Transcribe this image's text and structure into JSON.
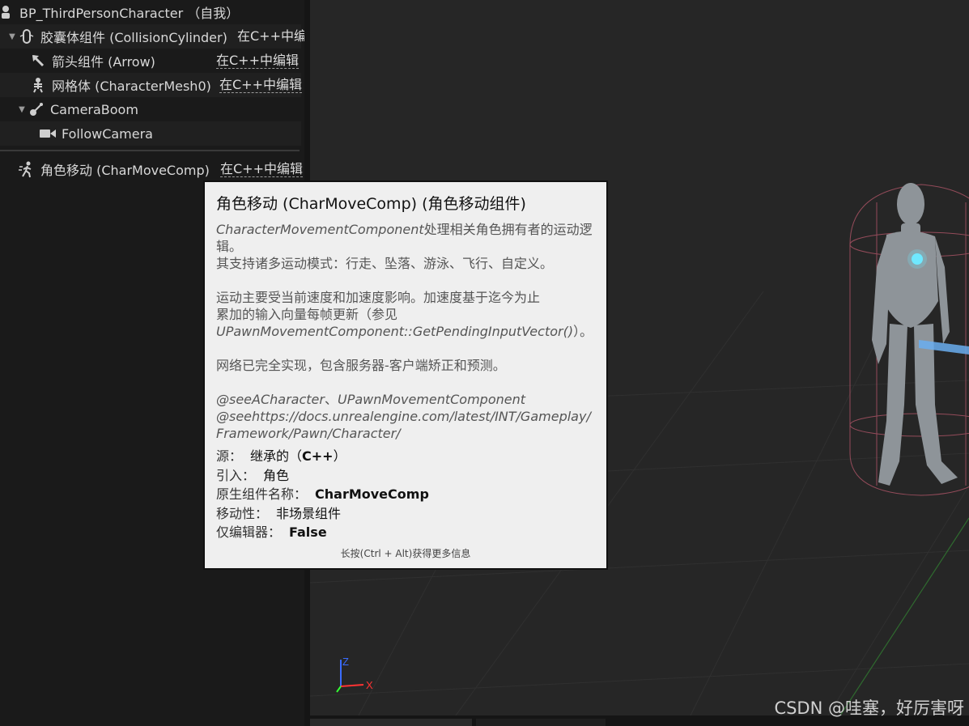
{
  "tree": {
    "root": {
      "label": "BP_ThirdPersonCharacter （自我）"
    },
    "items": [
      {
        "label": "胶囊体组件 (CollisionCylinder)",
        "edit_link": "在C++中编",
        "icon": "capsule-icon"
      },
      {
        "label": "箭头组件 (Arrow)",
        "edit_link": "在C++中编辑",
        "icon": "arrow-icon"
      },
      {
        "label": "网格体 (CharacterMesh0)",
        "edit_link": "在C++中编辑",
        "icon": "skeletal-mesh-icon"
      },
      {
        "label": "CameraBoom",
        "edit_link": "",
        "icon": "spring-arm-icon"
      },
      {
        "label": "FollowCamera",
        "edit_link": "",
        "icon": "camera-icon"
      }
    ],
    "movement": {
      "label": "角色移动 (CharMoveComp)",
      "edit_link": "在C++中编辑",
      "icon": "character-movement-icon"
    }
  },
  "tooltip": {
    "title": "角色移动 (CharMoveComp) (角色移动组件)",
    "desc": {
      "p1_class": "CharacterMovementComponent",
      "p1_text": "处理相关角色拥有者的运动逻辑。",
      "p2": "其支持诸多运动模式：行走、坠落、游泳、飞行、自定义。",
      "p3_line1": "运动主要受当前速度和加速度影响。加速度基于迄今为止",
      "p3_line2": "累加的输入向量每帧更新（参见",
      "p3_func": "UPawnMovementComponent::GetPendingInputVector()",
      "p3_end": "）。",
      "p4": "网络已完全实现，包含服务器-客户端矫正和预测。",
      "see1": "@seeACharacter",
      "see1_sep": "、",
      "see1b": "UPawnMovementComponent",
      "see2": "@seehttps://docs.unrealengine.com/latest/INT/Gameplay/",
      "see3": "Framework/Pawn/Character/"
    },
    "props": [
      {
        "label": "源：",
        "value": "继承的（",
        "bold": "C++",
        "tail": "）"
      },
      {
        "label": "引入：",
        "value": "角色"
      },
      {
        "label": "原生组件名称：",
        "bold": "CharMoveComp"
      },
      {
        "label": "移动性：",
        "value": "非场景组件"
      },
      {
        "label": "仅编辑器：",
        "bold": "False"
      }
    ],
    "hint": "长按(Ctrl + Alt)获得更多信息"
  },
  "viewport": {
    "axes": {
      "z": "Z",
      "x": "X",
      "z_color": "#3a6cff",
      "x_color": "#ff3333",
      "y_color": "#33ff33"
    }
  },
  "watermark": "CSDN @哇塞，好厉害呀"
}
